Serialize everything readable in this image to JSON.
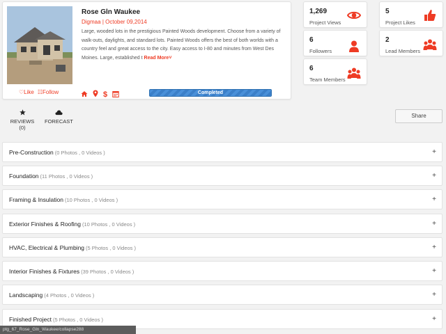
{
  "project": {
    "title": "Rose Gln Waukee",
    "builder": "Digmaa",
    "separator": "|",
    "date": "October 09,2014",
    "description": "Large, wooded lots in the prestigious Painted Woods development. Choose from a variety of walk-outs, daylights, and standard lots. Painted Woods offers the best of both worlds with a country feel and great access to the city. Easy access to I-80 and minutes from West Des Moines. Large, established t",
    "read_more": "Read More",
    "like": "Like",
    "follow": "Follow",
    "status": "Completed",
    "status_progress": 1.0,
    "icons": [
      "home-icon",
      "map-pin-icon",
      "dollar-icon",
      "calendar-icon"
    ]
  },
  "stats": {
    "views": {
      "value": "1,269",
      "label": "Project Views",
      "icon": "eye-icon"
    },
    "likes": {
      "value": "5",
      "label": "Project Likes",
      "icon": "thumbs-up-icon"
    },
    "followers": {
      "value": "6",
      "label": "Followers",
      "icon": "person-icon"
    },
    "leads": {
      "value": "2",
      "label": "Lead Members",
      "icon": "group-icon"
    },
    "team": {
      "value": "6",
      "label": "Team Members",
      "icon": "group-icon"
    }
  },
  "tabs": [
    {
      "label": "REVIEWS (0)",
      "icon": "star-icon"
    },
    {
      "label": "FORECAST",
      "icon": "cloud-icon"
    }
  ],
  "share_label": "Share",
  "sections": [
    {
      "name": "Pre-Construction",
      "count": "(0 Photos , 0 Videos )"
    },
    {
      "name": "Foundation",
      "count": "(11 Photos , 0 Videos )"
    },
    {
      "name": "Framing & Insulation",
      "count": "(10 Photos , 0 Videos )"
    },
    {
      "name": "Exterior Finishes & Roofing",
      "count": "(10 Photos , 0 Videos )"
    },
    {
      "name": "HVAC, Electrical & Plumbing",
      "count": "(5 Photos , 0 Videos )"
    },
    {
      "name": "Interior Finishes & Fixtures",
      "count": "(39 Photos , 0 Videos )"
    },
    {
      "name": "Landscaping",
      "count": "(4 Photos , 0 Videos )"
    },
    {
      "name": "Finished Project",
      "count": "(5 Photos , 0 Videos )"
    }
  ],
  "expand_symbol": "+",
  "status_bar": "ptg_67_Rose_Gln_Waukee/collapse288",
  "colors": {
    "accent": "#ee3b24",
    "progress": "#4a90d9"
  }
}
